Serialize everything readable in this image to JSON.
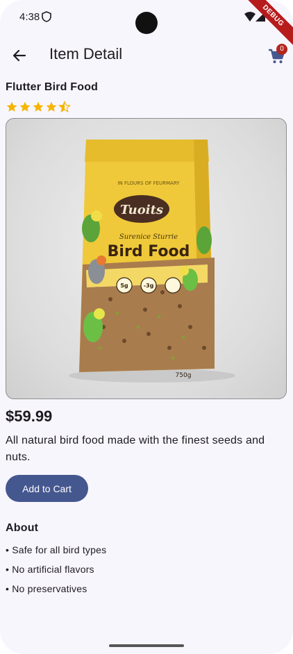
{
  "status_bar": {
    "time": "4:38",
    "debug_label": "DEBUG"
  },
  "app_bar": {
    "title": "Item Detail",
    "cart_count": "0"
  },
  "product": {
    "name": "Flutter Bird Food",
    "rating": 4.5,
    "rating_max": 5,
    "price": "$59.99",
    "description": "All natural bird food made with the finest seeds and nuts.",
    "add_to_cart_label": "Add to Cart",
    "package": {
      "brand": "Tuoits",
      "tagline": "Surenice Sturrie",
      "name": "Bird Food",
      "weight": "750g",
      "badge_1_value": "5g",
      "badge_2_value": "-3g",
      "header_text": "IN FLOURS OF FEURMARY"
    }
  },
  "about": {
    "heading": "About",
    "items": [
      "• Safe for all bird types",
      "• No artificial flavors",
      "• No preservatives"
    ]
  },
  "colors": {
    "accent": "#45578f",
    "badge": "#b3261e",
    "background": "#f8f6fd",
    "package_yellow": "#f0cc3c"
  }
}
